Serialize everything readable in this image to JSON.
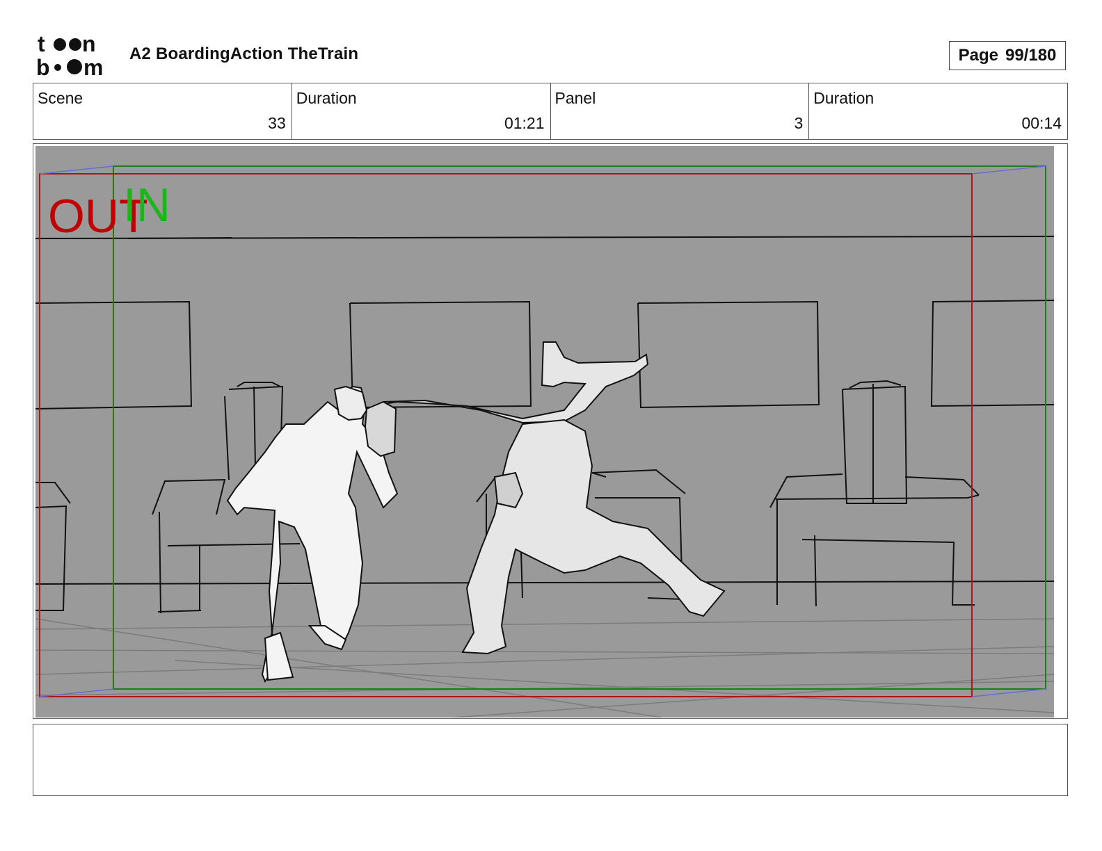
{
  "header": {
    "logo_text": "toon boom",
    "project_title": "A2 BoardingAction TheTrain",
    "page_label": "Page",
    "page_number": "99/180"
  },
  "info": [
    {
      "label": "Scene",
      "value": "33"
    },
    {
      "label": "Duration",
      "value": "01:21"
    },
    {
      "label": "Panel",
      "value": "3"
    },
    {
      "label": "Duration",
      "value": "00:14"
    }
  ],
  "panel": {
    "overlay_out": "OUT",
    "overlay_in": "IN",
    "background_color": "#9a9a9a",
    "out_frame_color": "#b01515",
    "in_frame_color": "#1f7a1f",
    "overlay_out_color": "#c00000",
    "overlay_in_color": "#1db51d"
  },
  "notes": {
    "text": ""
  }
}
